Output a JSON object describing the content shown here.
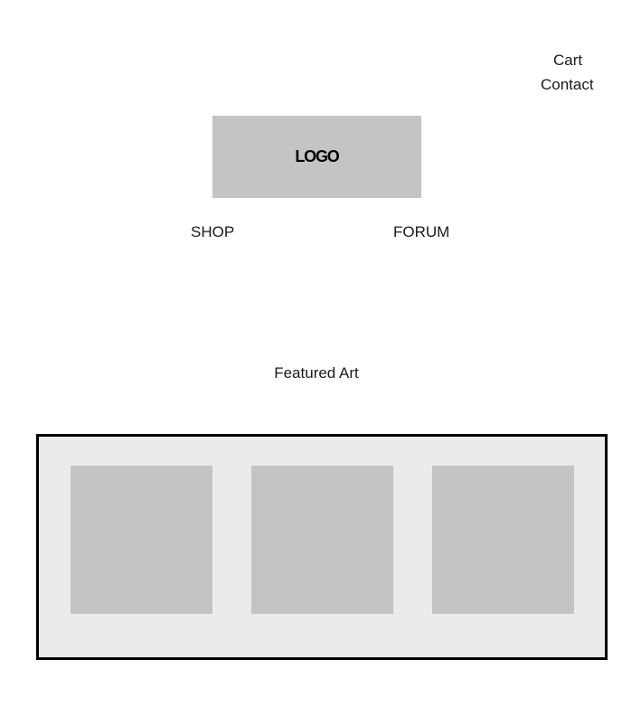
{
  "header": {
    "cart_label": "Cart",
    "contact_label": "Contact",
    "logo_text": "LOGO"
  },
  "nav": {
    "items": [
      {
        "label": "SHOP"
      },
      {
        "label": "FORUM"
      }
    ]
  },
  "featured": {
    "title": "Featured Art",
    "items_count": 3
  },
  "colors": {
    "placeholder_gray": "#c4c4c4",
    "gallery_background": "#ebebeb",
    "gallery_border": "#000000",
    "text": "#1a1a1a"
  }
}
